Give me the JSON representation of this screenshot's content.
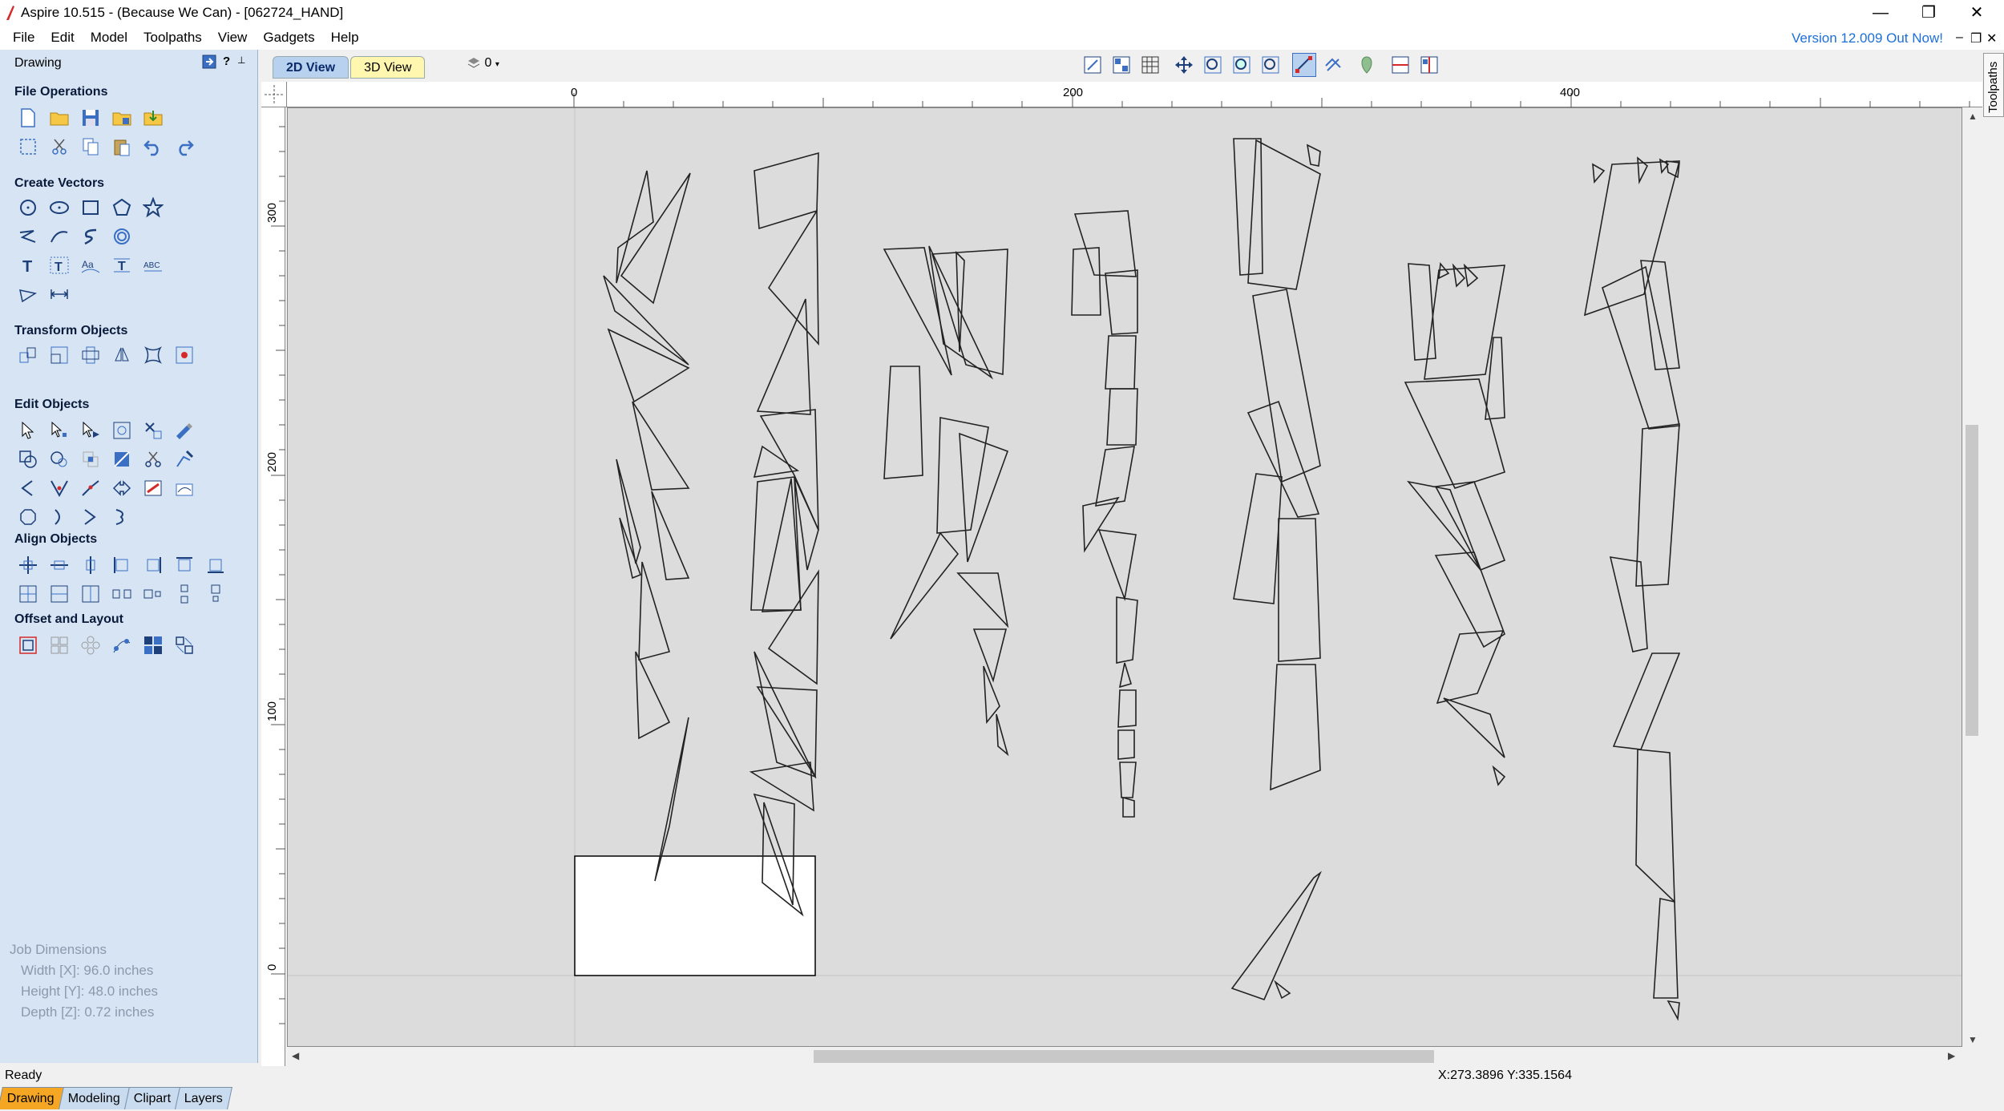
{
  "window": {
    "title": "Aspire 10.515 - (Because We Can) - [062724_HAND]",
    "minimize": "—",
    "restore": "❐",
    "close": "✕"
  },
  "menu": {
    "items": [
      "File",
      "Edit",
      "Model",
      "Toolpaths",
      "View",
      "Gadgets",
      "Help"
    ],
    "version_notice": "Version 12.009 Out Now!"
  },
  "panel": {
    "title": "Drawing",
    "help": "?",
    "pin": "📌",
    "sections": {
      "file_operations": "File Operations",
      "create_vectors": "Create Vectors",
      "transform_objects": "Transform Objects",
      "edit_objects": "Edit Objects",
      "align_objects": "Align Objects",
      "offset_layout": "Offset and Layout"
    }
  },
  "job_dimensions": {
    "title": "Job Dimensions",
    "width": "Width  [X]: 96.0 inches",
    "height": "Height [Y]: 48.0 inches",
    "depth": "Depth  [Z]: 0.72 inches"
  },
  "bottom_tabs": [
    "Drawing",
    "Modeling",
    "Clipart",
    "Layers"
  ],
  "view_tabs": {
    "view_2d": "2D View",
    "view_3d": "3D View"
  },
  "layer_control": "0",
  "side_tab": "Toolpaths",
  "rulers": {
    "top_labels": [
      "0",
      "200",
      "400"
    ],
    "left_labels": [
      "300",
      "200",
      "100",
      "0"
    ]
  },
  "status": {
    "text": "Ready",
    "coords": "X:273.3896 Y:335.1564"
  }
}
